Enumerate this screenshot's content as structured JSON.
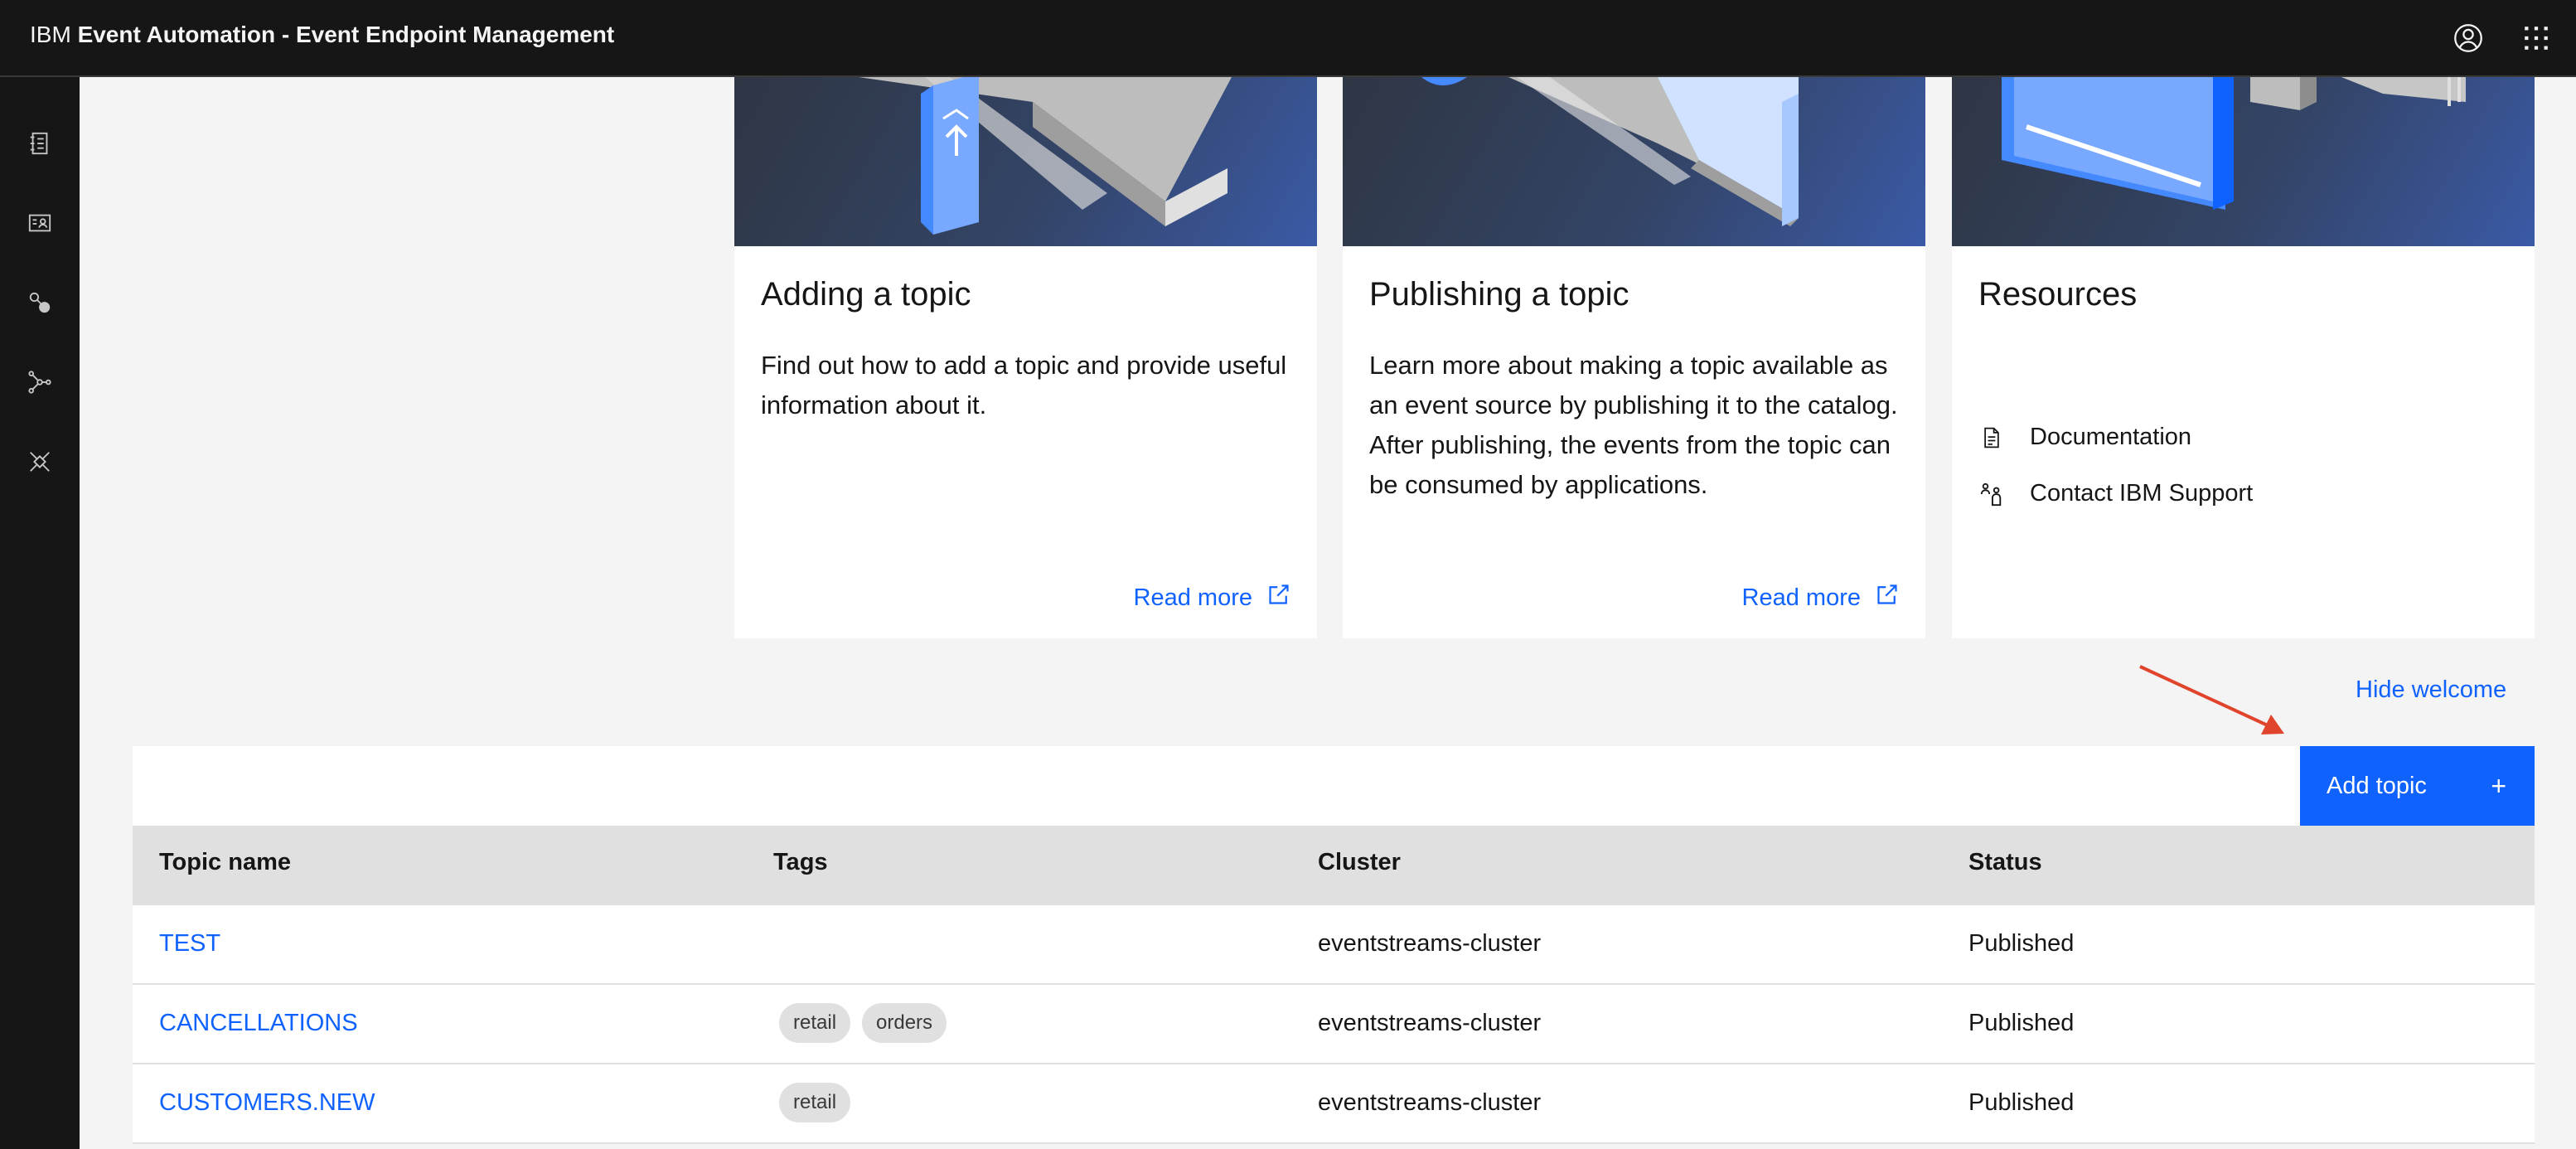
{
  "header": {
    "brand_prefix": "IBM",
    "brand_name": "Event Automation - Event Endpoint Management",
    "profile_icon": "user-avatar-icon",
    "switcher_icon": "app-switcher-icon"
  },
  "sidenav": {
    "items": [
      {
        "icon": "catalog-icon"
      },
      {
        "icon": "subscriptions-icon"
      },
      {
        "icon": "topics-icon"
      },
      {
        "icon": "gateways-icon"
      },
      {
        "icon": "control-policies-icon"
      }
    ]
  },
  "tiles": [
    {
      "title": "Adding a topic",
      "description": "Find out how to add a topic and provide useful information about it.",
      "link": "Read more"
    },
    {
      "title": "Publishing a topic",
      "description": "Learn more about making a topic available as an event source by publishing it to the catalog. After publishing, the events from the topic can be consumed by applications.",
      "link": "Read more"
    },
    {
      "title": "Resources",
      "items": [
        {
          "label": "Documentation",
          "icon": "document-icon"
        },
        {
          "label": "Contact IBM Support",
          "icon": "support-icon"
        }
      ]
    }
  ],
  "hide_welcome": "Hide welcome",
  "annotation_arrow_color": "#e0442c",
  "add_topic": {
    "label": "Add topic",
    "icon": "+"
  },
  "table": {
    "columns": [
      "Topic name",
      "Tags",
      "Cluster",
      "Status"
    ],
    "rows": [
      {
        "name": "TEST",
        "tags": [],
        "cluster": "eventstreams-cluster",
        "status": "Published"
      },
      {
        "name": "CANCELLATIONS",
        "tags": [
          "retail",
          "orders"
        ],
        "cluster": "eventstreams-cluster",
        "status": "Published"
      },
      {
        "name": "CUSTOMERS.NEW",
        "tags": [
          "retail"
        ],
        "cluster": "eventstreams-cluster",
        "status": "Published"
      }
    ]
  },
  "colors": {
    "accent": "#0f62fe",
    "header_bg": "#161616",
    "page_bg": "#f4f4f4"
  }
}
